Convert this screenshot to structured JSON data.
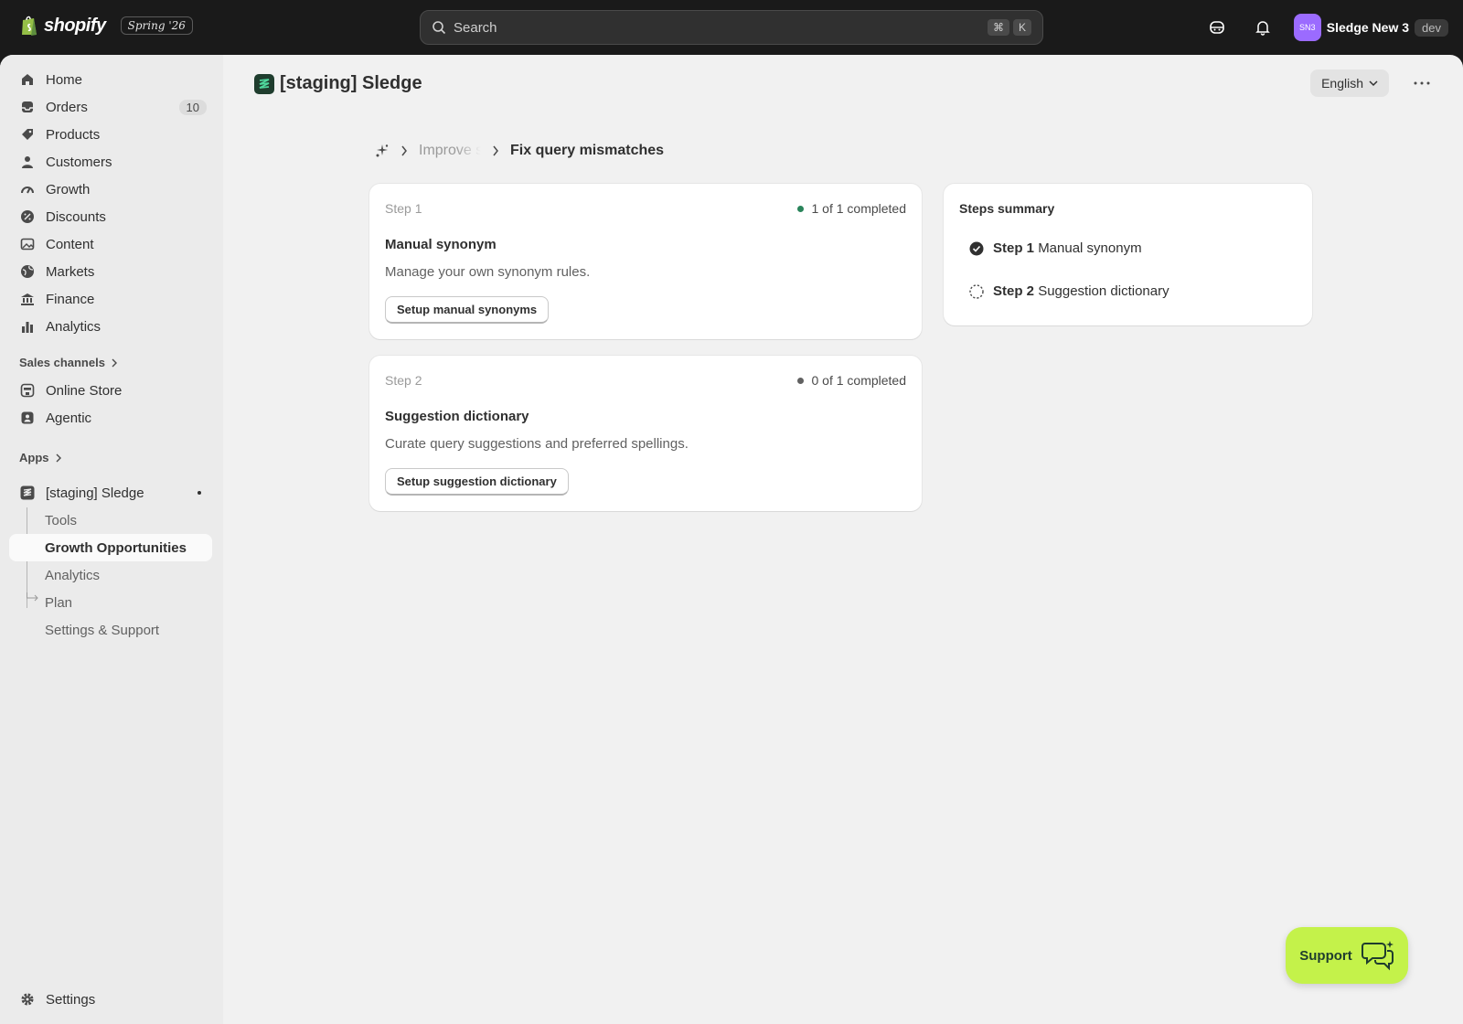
{
  "topbar": {
    "brand": "shopify",
    "edition": "Spring '26",
    "search_placeholder": "Search",
    "shortcut_keys": [
      "⌘",
      "K"
    ],
    "store_initials": "SN3",
    "store_name": "Sledge New 3",
    "env_badge": "dev"
  },
  "sidebar": {
    "items": [
      {
        "label": "Home",
        "icon": "home-icon"
      },
      {
        "label": "Orders",
        "icon": "inbox-icon",
        "count": "10"
      },
      {
        "label": "Products",
        "icon": "tag-icon"
      },
      {
        "label": "Customers",
        "icon": "person-icon"
      },
      {
        "label": "Growth",
        "icon": "gauge-icon"
      },
      {
        "label": "Discounts",
        "icon": "discount-icon"
      },
      {
        "label": "Content",
        "icon": "image-icon"
      },
      {
        "label": "Markets",
        "icon": "globe-icon"
      },
      {
        "label": "Finance",
        "icon": "bank-icon"
      },
      {
        "label": "Analytics",
        "icon": "bar-chart-icon"
      }
    ],
    "sales_channels_label": "Sales channels",
    "channels": [
      {
        "label": "Online Store",
        "icon": "store-icon"
      },
      {
        "label": "Agentic",
        "icon": "agent-icon"
      }
    ],
    "apps_label": "Apps",
    "app": {
      "label": "[staging] Sledge",
      "subitems": [
        "Tools",
        "Growth Opportunities",
        "Analytics",
        "Plan",
        "Settings & Support"
      ],
      "active_index": 1
    },
    "settings_label": "Settings"
  },
  "main": {
    "app_title": "[staging] Sledge",
    "language": "English",
    "breadcrumb": {
      "parent": "Improve search",
      "current": "Fix query mismatches"
    },
    "steps": [
      {
        "label": "Step 1",
        "status": "1 of 1 completed",
        "status_color": "#29845a",
        "title": "Manual synonym",
        "description": "Manage your own synonym rules.",
        "button": "Setup manual synonyms"
      },
      {
        "label": "Step 2",
        "status": "0 of 1 completed",
        "status_color": "#616161",
        "title": "Suggestion dictionary",
        "description": "Curate query suggestions and preferred spellings.",
        "button": "Setup suggestion dictionary"
      }
    ],
    "summary": {
      "title": "Steps summary",
      "rows": [
        {
          "step": "Step 1",
          "name": "Manual synonym",
          "state": "completed"
        },
        {
          "step": "Step 2",
          "name": "Suggestion dictionary",
          "state": "pending"
        }
      ]
    },
    "support_label": "Support"
  },
  "colors": {
    "topbar": "#1a1a1a",
    "support": "#c4f24a",
    "avatar": "#9b6bff"
  }
}
